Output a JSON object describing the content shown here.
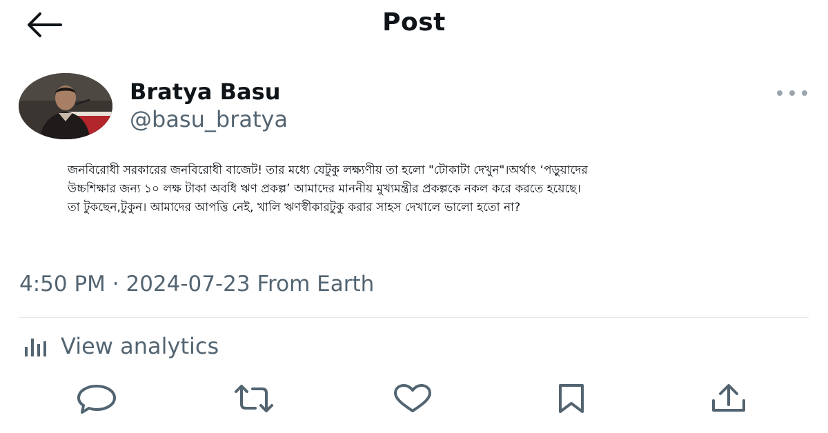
{
  "header": {
    "title": "Post",
    "back_icon": "arrow-left-icon"
  },
  "author": {
    "name": "Bratya Basu",
    "handle": "@basu_bratya",
    "avatar": "profile-photo"
  },
  "more_icon": "more-horizontal-icon",
  "tweet": {
    "lines": [
      "জনবিরোধী সরকারের জনবিরোধী বাজেট! তার মধ্যে যেটুকু লক্ষ্যণীয় তা হলো \"টোকাটা দেখুন\"।অর্থাৎ ‘পড়ুয়াদের",
      "উচ্চশিক্ষার জন্য ১০ লক্ষ টাকা অবধি ঋণ প্রকল্প’ আমাদের মাননীয় মুখ্যমন্ত্রীর প্রকল্পকে নকল করে  করতে হয়েছে।",
      "তা টুকছেন,টুকুন। আমাদের আপত্তি নেই, খালি ঋণস্বীকারটুকু করার সাহস দেখালে ভালো হতো না?"
    ]
  },
  "meta": {
    "text": "4:50 PM · 2024-07-23 From Earth"
  },
  "analytics": {
    "label": "View analytics",
    "icon": "bar-chart-icon"
  },
  "actions": [
    {
      "name": "reply",
      "icon": "reply-icon"
    },
    {
      "name": "repost",
      "icon": "repost-icon"
    },
    {
      "name": "like",
      "icon": "heart-icon"
    },
    {
      "name": "bookmark",
      "icon": "bookmark-icon"
    },
    {
      "name": "share",
      "icon": "share-icon"
    }
  ],
  "colors": {
    "text_primary": "#0f1419",
    "text_secondary": "#536471",
    "divider": "#e4e8eb",
    "background": "#ffffff"
  }
}
